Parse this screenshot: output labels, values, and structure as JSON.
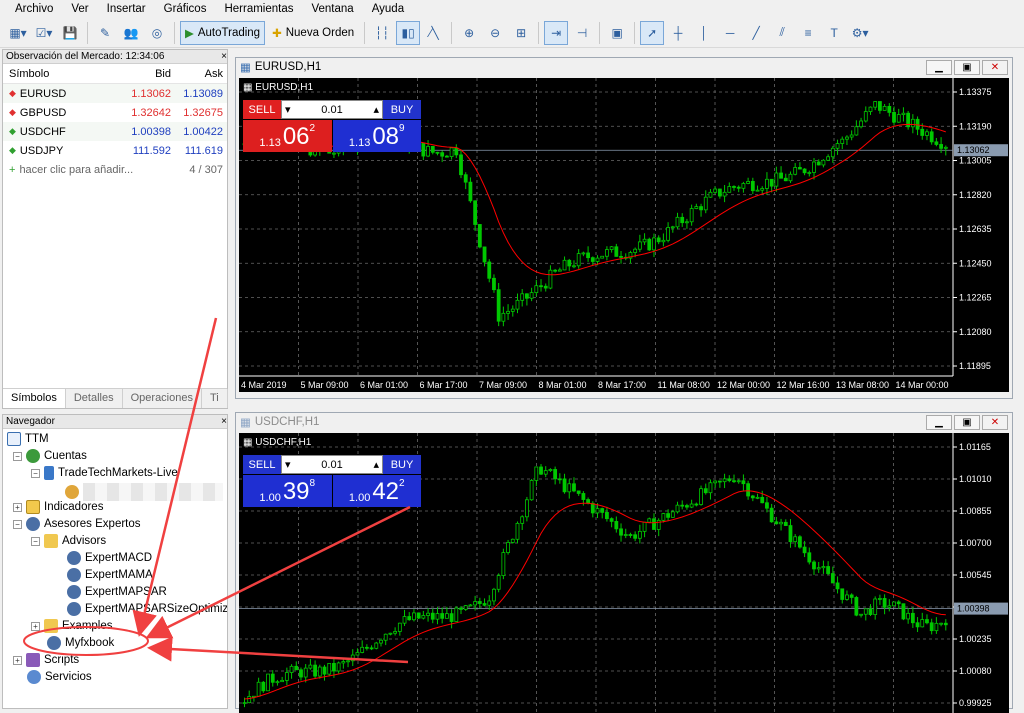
{
  "menu": [
    "Archivo",
    "Ver",
    "Insertar",
    "Gráficos",
    "Herramientas",
    "Ventana",
    "Ayuda"
  ],
  "toolbar": {
    "autotrading": "AutoTrading",
    "new_order": "Nueva Orden"
  },
  "market_watch": {
    "title": "Observación del Mercado: 12:34:06",
    "columns": [
      "Símbolo",
      "Bid",
      "Ask"
    ],
    "rows": [
      {
        "symbol": "EURUSD",
        "bid": "1.13062",
        "ask": "1.13089",
        "dir": "down"
      },
      {
        "symbol": "GBPUSD",
        "bid": "1.32642",
        "ask": "1.32675",
        "dir": "down"
      },
      {
        "symbol": "USDCHF",
        "bid": "1.00398",
        "ask": "1.00422",
        "dir": "up"
      },
      {
        "symbol": "USDJPY",
        "bid": "111.592",
        "ask": "111.619",
        "dir": "up"
      }
    ],
    "add_hint": "hacer clic para añadir...",
    "count": "4 / 307",
    "tabs": [
      "Símbolos",
      "Detalles",
      "Operaciones",
      "Ti"
    ]
  },
  "navigator": {
    "title": "Navegador",
    "root": "TTM",
    "accounts": "Cuentas",
    "account_name": "TradeTechMarkets-Live",
    "indicators": "Indicadores",
    "experts": "Asesores Expertos",
    "advisors": "Advisors",
    "ea_items": [
      "ExpertMACD",
      "ExpertMAMA",
      "ExpertMAPSAR",
      "ExpertMAPSARSizeOptimized"
    ],
    "examples": "Examples",
    "myfxbook": "Myfxbook",
    "scripts": "Scripts",
    "services": "Servicios"
  },
  "charts": [
    {
      "window_title": "EURUSD,H1",
      "label": "EURUSD,H1",
      "sell": "SELL",
      "buy": "BUY",
      "lot": "0.01",
      "sell_small": "1.13",
      "sell_big": "06",
      "sell_sup": "2",
      "buy_small": "1.13",
      "buy_big": "08",
      "buy_sup": "9",
      "y_ticks": [
        "1.13375",
        "1.13190",
        "1.13005",
        "1.12820",
        "1.12635",
        "1.12450",
        "1.12265",
        "1.12080",
        "1.11895"
      ],
      "current_price": "1.13062",
      "x_ticks": [
        "4 Mar 2019",
        "5 Mar 09:00",
        "6 Mar 01:00",
        "6 Mar 17:00",
        "7 Mar 09:00",
        "8 Mar 01:00",
        "8 Mar 17:00",
        "11 Mar 08:00",
        "12 Mar 00:00",
        "12 Mar 16:00",
        "13 Mar 08:00",
        "14 Mar 00:00"
      ],
      "candle_color": "#00c800",
      "ma_color": "#ff0000"
    },
    {
      "window_title": "USDCHF,H1",
      "label": "USDCHF,H1",
      "sell": "SELL",
      "buy": "BUY",
      "lot": "0.01",
      "sell_small": "1.00",
      "sell_big": "39",
      "sell_sup": "8",
      "buy_small": "1.00",
      "buy_big": "42",
      "buy_sup": "2",
      "y_ticks": [
        "1.01165",
        "1.01010",
        "1.00855",
        "1.00700",
        "1.00545",
        "1.00390",
        "1.00235",
        "1.00080",
        "0.99925"
      ],
      "current_price": "1.00398",
      "candle_color": "#00c800",
      "ma_color": "#ff0000"
    }
  ],
  "annotation_color": "#f04040"
}
